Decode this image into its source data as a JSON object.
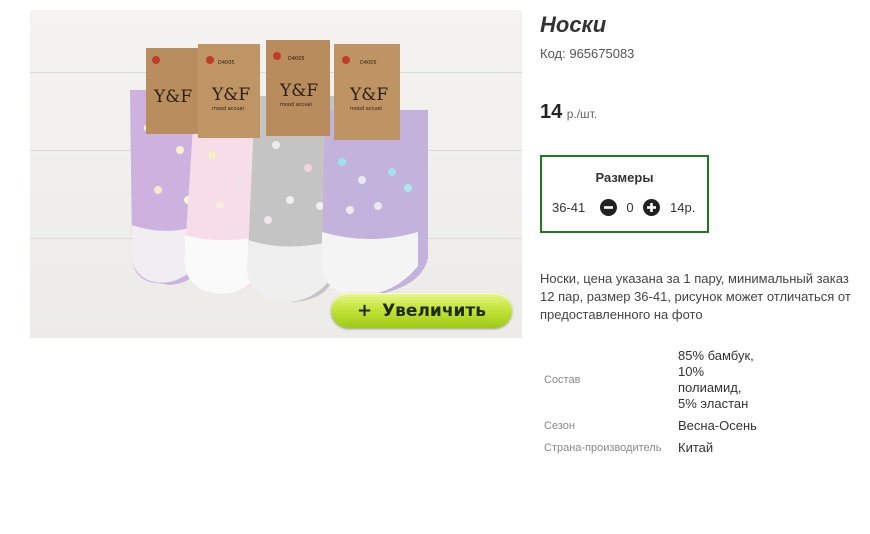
{
  "product": {
    "title": "Носки",
    "code_label": "Код:",
    "code": "965675083",
    "price_amount": "14",
    "price_unit": "р./шт.",
    "image_zoom_label": "Увеличить",
    "image_zoom_icon": "+"
  },
  "sizes": {
    "title": "Размеры",
    "rows": [
      {
        "size": "36-41",
        "quantity": "0",
        "price": "14р."
      }
    ]
  },
  "description": "Носки, цена указана за 1 пару, минимальный заказ 12 пар, размер 36-41, рисунок может отличаться от предоставленного на фото",
  "specs": [
    {
      "name": "Состав",
      "value": "85% бамбук, 10% полиамид, 5% эластан"
    },
    {
      "name": "Сезон",
      "value": "Весна-Осень"
    },
    {
      "name": "Страна-производитель",
      "value": "Китай"
    }
  ],
  "image_labels": {
    "brand": "Y&F",
    "subbrand": "mood accuei",
    "article": "D4005"
  },
  "colors": {
    "sizes_border": "#1d7a1d",
    "zoom_button": "#b6dc2c",
    "sock_purple": "#cdb2e0",
    "sock_pink": "#f6dde8",
    "sock_grey": "#c4c4c4",
    "sock_lilac": "#c3b3dc",
    "tag_kraft": "#b98e5f"
  }
}
